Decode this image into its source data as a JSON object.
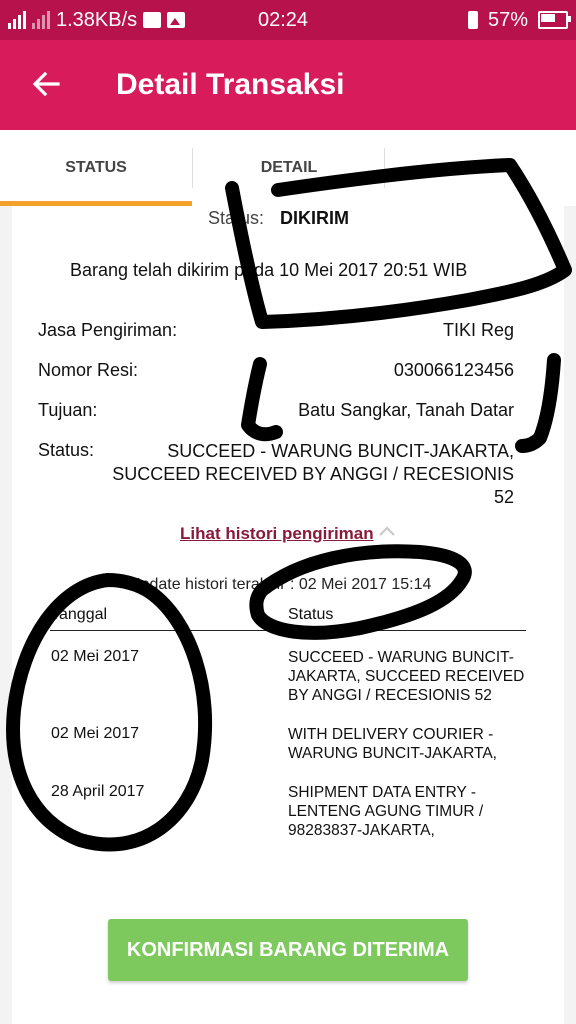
{
  "statusbar": {
    "speed": "1.38KB/s",
    "time": "02:24",
    "battery": "57%"
  },
  "appbar": {
    "title": "Detail Transaksi"
  },
  "tabs": [
    {
      "label": "STATUS"
    },
    {
      "label": "DETAIL"
    }
  ],
  "status": {
    "label": "Status:",
    "value": "DIKIRIM",
    "sent_text": "Barang telah dikirim pada 10 Mei 2017 20:51 WIB"
  },
  "info": {
    "jasa_label": "Jasa Pengiriman:",
    "jasa_value": "TIKI Reg",
    "resi_label": "Nomor Resi:",
    "resi_value": "030066123456",
    "tujuan_label": "Tujuan:",
    "tujuan_value": "Batu Sangkar, Tanah Datar",
    "status_label": "Status:",
    "status_value": "SUCCEED - WARUNG BUNCIT-JAKARTA, SUCCEED RECEIVED BY ANGGI / RECESIONIS 52"
  },
  "history": {
    "link": "Lihat histori pengiriman",
    "update": "Update histori terakhir : 02 Mei 2017 15:14",
    "col_date": "Tanggal",
    "col_status": "Status",
    "rows": [
      {
        "date": "02 Mei 2017",
        "status": "SUCCEED - WARUNG BUNCIT-JAKARTA, SUCCEED RECEIVED BY ANGGI / RECESIONIS 52"
      },
      {
        "date": "02 Mei 2017",
        "status": "WITH DELIVERY COURIER - WARUNG BUNCIT-JAKARTA,"
      },
      {
        "date": "28 April 2017",
        "status": "SHIPMENT DATA ENTRY - LENTENG AGUNG TIMUR / 98283837-JAKARTA,"
      }
    ]
  },
  "confirm_button": "KONFIRMASI BARANG DITERIMA",
  "colors": {
    "statusbar": "#b8124c",
    "appbar": "#d81b5a",
    "tab_indicator": "#f3a12b",
    "button": "#7dc95e",
    "link": "#8a1a3a"
  }
}
